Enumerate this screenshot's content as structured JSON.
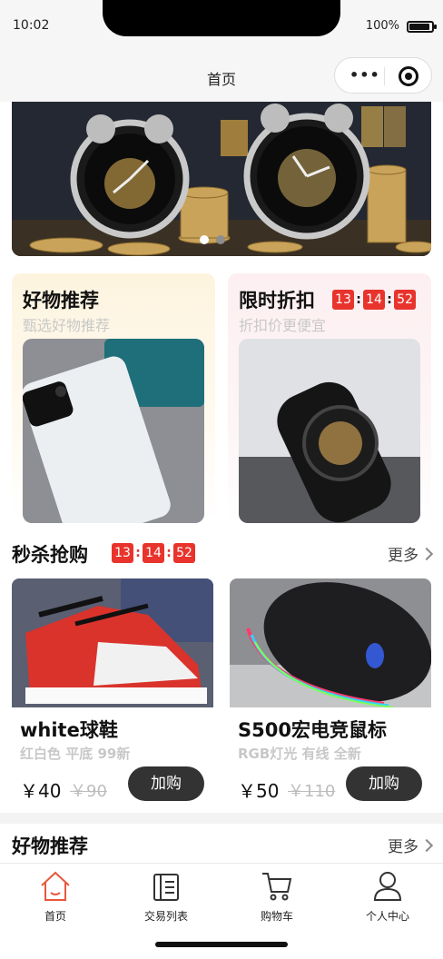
{
  "status_bar": {
    "time": "10:02",
    "battery": "100%"
  },
  "navbar": {
    "title": "首页",
    "menu_dots": "•••"
  },
  "banner": {
    "active_slide": 1,
    "slide_count": 2
  },
  "promo_left": {
    "title": "好物推荐",
    "subtitle": "甄选好物推荐"
  },
  "promo_right": {
    "title": "限时折扣",
    "subtitle": "折扣价更便宜",
    "countdown": {
      "h": "13",
      "m": "14",
      "s": "52"
    }
  },
  "flash_sale": {
    "title": "秒杀抢购",
    "countdown": {
      "h": "13",
      "m": "14",
      "s": "52"
    },
    "more": "更多",
    "products": [
      {
        "name": "white球鞋",
        "desc": "红白色 平底 99新",
        "price": "￥40",
        "old_price": "￥90",
        "button": "加购"
      },
      {
        "name": "S500宏电竞鼠标",
        "desc": "RGB灯光 有线 全新",
        "price": "￥50",
        "old_price": "￥110",
        "button": "加购"
      }
    ]
  },
  "recommend": {
    "title": "好物推荐",
    "more": "更多"
  },
  "tabbar": {
    "active": 0,
    "items": [
      {
        "label": "首页",
        "icon": "home-icon"
      },
      {
        "label": "交易列表",
        "icon": "list-icon"
      },
      {
        "label": "购物车",
        "icon": "cart-icon"
      },
      {
        "label": "个人中心",
        "icon": "user-icon"
      }
    ]
  },
  "colors": {
    "accent": "#e8342c",
    "button_dark": "#333333",
    "tab_active": "#e8573c"
  }
}
